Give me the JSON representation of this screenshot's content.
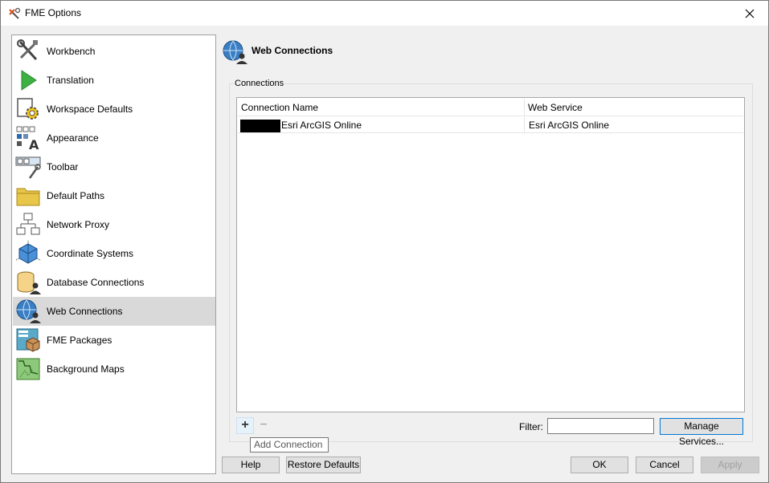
{
  "window": {
    "title": "FME Options"
  },
  "sidebar": {
    "items": [
      {
        "label": "Workbench",
        "icon": "workbench-tools-icon"
      },
      {
        "label": "Translation",
        "icon": "translation-play-icon"
      },
      {
        "label": "Workspace Defaults",
        "icon": "workspace-defaults-gear-icon"
      },
      {
        "label": "Appearance",
        "icon": "appearance-font-icon"
      },
      {
        "label": "Toolbar",
        "icon": "toolbar-icon"
      },
      {
        "label": "Default Paths",
        "icon": "folder-icon"
      },
      {
        "label": "Network Proxy",
        "icon": "network-icon"
      },
      {
        "label": "Coordinate Systems",
        "icon": "coordinate-cube-icon"
      },
      {
        "label": "Database Connections",
        "icon": "database-user-icon"
      },
      {
        "label": "Web Connections",
        "icon": "globe-user-icon",
        "selected": true
      },
      {
        "label": "FME Packages",
        "icon": "package-box-icon"
      },
      {
        "label": "Background Maps",
        "icon": "map-icon"
      }
    ]
  },
  "main": {
    "title": "Web Connections",
    "group_label": "Connections",
    "table": {
      "columns": [
        "Connection Name",
        "Web Service"
      ],
      "rows": [
        {
          "name": "Esri ArcGIS Online",
          "service": "Esri ArcGIS Online"
        }
      ]
    },
    "add_label": "+",
    "remove_label": "−",
    "tooltip": "Add Connection",
    "filter_label": "Filter:",
    "filter_value": "",
    "manage_services_label": "Manage Services..."
  },
  "footer": {
    "help": "Help",
    "restore_defaults": "Restore Defaults",
    "ok": "OK",
    "cancel": "Cancel",
    "apply": "Apply"
  }
}
